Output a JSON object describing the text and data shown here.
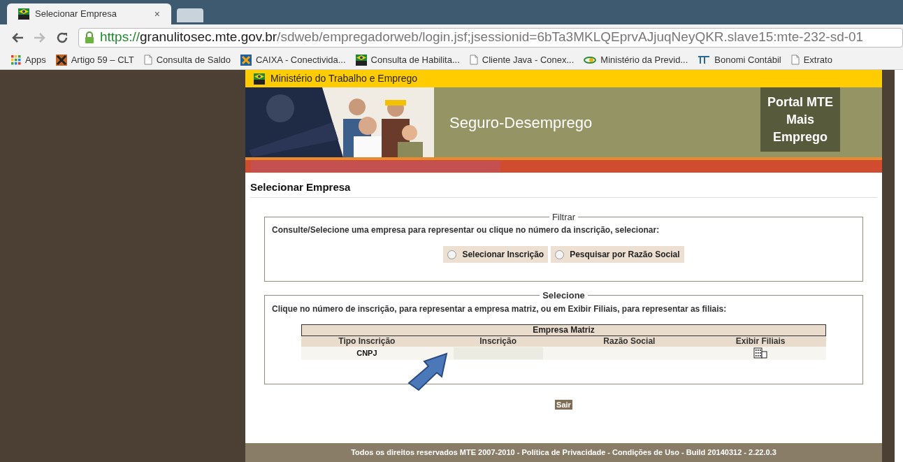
{
  "browser": {
    "tabs": [
      {
        "title": "Selecionar Empresa",
        "close": "×",
        "selected": true
      },
      {
        "kind": "new",
        "selected": false
      }
    ],
    "url": {
      "scheme": "https://",
      "host": "granulitosec.mte.gov.br",
      "path": "/sdweb/empregadorweb/login.jsf;jsessionid=6bTa3MKLQEprvAJjuqNeyQKR.slave15:mte-232-sd-01"
    },
    "bookmarks": [
      {
        "kind": "apps",
        "label": "Apps"
      },
      {
        "kind": "site",
        "label": "Artigo 59 – CLT"
      },
      {
        "kind": "page",
        "label": "Consulta de Saldo"
      },
      {
        "kind": "caixa",
        "label": "CAIXA - Conectivida..."
      },
      {
        "kind": "mte",
        "label": "Consulta de Habilita..."
      },
      {
        "kind": "page",
        "label": "Cliente Java - Conex..."
      },
      {
        "kind": "prev",
        "label": "Ministério da Previd..."
      },
      {
        "kind": "bonomi",
        "label": "Bonomi Contábil"
      },
      {
        "kind": "page",
        "label": "Extrato"
      }
    ]
  },
  "header": {
    "ministry": "Ministério do Trabalho e Emprego",
    "title": "Seguro-Desemprego",
    "portal": "Portal MTE Mais Emprego"
  },
  "page_title": "Selecionar Empresa",
  "filter": {
    "legend": "Filtrar",
    "instruction": "Consulte/Selecione uma empresa para representar ou clique no número da inscrição, selecionar:",
    "options": [
      {
        "label": "Selecionar Inscrição",
        "selected": false
      },
      {
        "label": "Pesquisar por Razão Social",
        "selected": false
      }
    ]
  },
  "select": {
    "legend": "Selecione",
    "instruction": "Clique no número de inscrição, para representar a empresa matriz, ou em Exibir Filiais, para representar as filiais:",
    "table": {
      "caption": "Empresa Matriz",
      "columns": [
        "Tipo Inscrição",
        "Inscrição",
        "Razão Social",
        "Exibir Filiais"
      ],
      "rows": [
        {
          "tipo": "CNPJ"
        }
      ]
    }
  },
  "exit_button": "Sair",
  "footer": "Todos os direitos reservados MTE 2007-2010 - Política de Privacidade - Condições de Uso - Build 20140312 - 2.22.0.3"
}
